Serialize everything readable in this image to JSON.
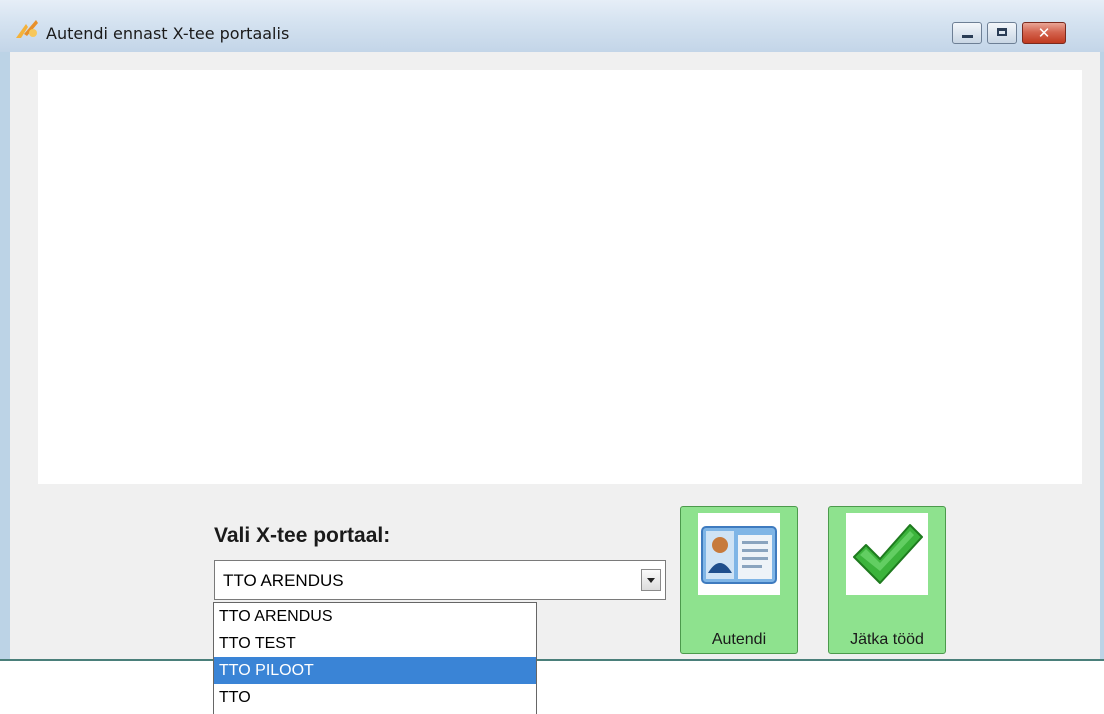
{
  "window": {
    "title": "Autendi ennast X-tee portaalis",
    "close_glyph": "✕"
  },
  "form": {
    "label": "Vali X-tee portaal:",
    "selected_value": "TTO ARENDUS",
    "options": [
      "TTO ARENDUS",
      "TTO TEST",
      "TTO PILOOT",
      "TTO"
    ],
    "highlighted_option": "TTO PILOOT"
  },
  "buttons": {
    "authenticate": {
      "label": "Autendi",
      "icon": "id-card-icon"
    },
    "continue": {
      "label": "Jätka tööd",
      "icon": "checkmark-icon"
    }
  },
  "colors": {
    "button_bg": "#8ee28e",
    "highlight": "#3a84d6",
    "title_bar": "#d4e2f0",
    "close_button": "#c0391f"
  }
}
